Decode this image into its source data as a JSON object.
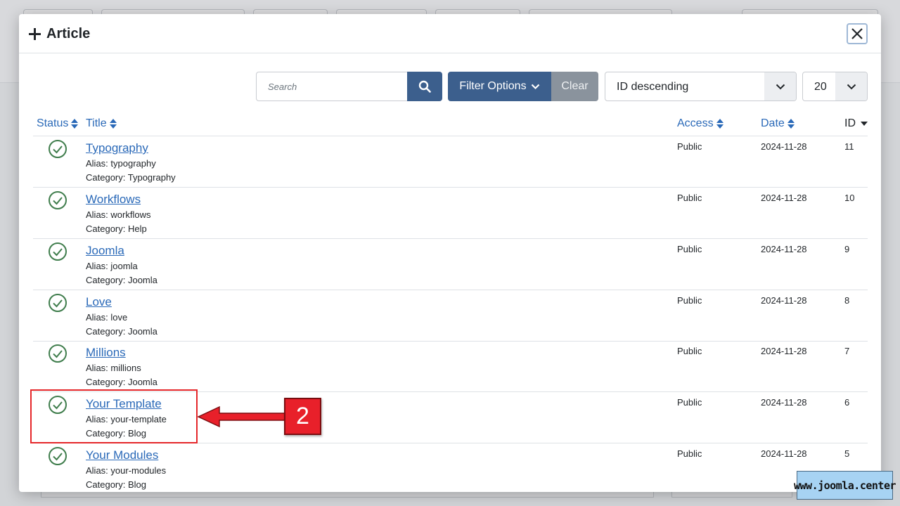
{
  "modal": {
    "title": "Article",
    "close_label": "×"
  },
  "search": {
    "placeholder": "Search"
  },
  "filters": {
    "filter_label": "Filter Options",
    "clear_label": "Clear",
    "sort_value": "ID descending",
    "limit_value": "20"
  },
  "table": {
    "headers": {
      "status": "Status",
      "title": "Title",
      "access": "Access",
      "date": "Date",
      "id": "ID"
    },
    "rows": [
      {
        "title": "Typography",
        "alias": "Alias: typography",
        "category": "Category: Typography",
        "access": "Public",
        "date": "2024-11-28",
        "id": "11"
      },
      {
        "title": "Workflows",
        "alias": "Alias: workflows",
        "category": "Category: Help",
        "access": "Public",
        "date": "2024-11-28",
        "id": "10"
      },
      {
        "title": "Joomla",
        "alias": "Alias: joomla",
        "category": "Category: Joomla",
        "access": "Public",
        "date": "2024-11-28",
        "id": "9"
      },
      {
        "title": "Love",
        "alias": "Alias: love",
        "category": "Category: Joomla",
        "access": "Public",
        "date": "2024-11-28",
        "id": "8"
      },
      {
        "title": "Millions",
        "alias": "Alias: millions",
        "category": "Category: Joomla",
        "access": "Public",
        "date": "2024-11-28",
        "id": "7"
      },
      {
        "title": "Your Template",
        "alias": "Alias: your-template",
        "category": "Category: Blog",
        "access": "Public",
        "date": "2024-11-28",
        "id": "6"
      },
      {
        "title": "Your Modules",
        "alias": "Alias: your-modules",
        "category": "Category: Blog",
        "access": "Public",
        "date": "2024-11-28",
        "id": "5"
      }
    ]
  },
  "annotation": {
    "step_number": "2"
  },
  "watermark": {
    "text": "www.joomla.center"
  },
  "colors": {
    "primary": "#3c5f8d",
    "link": "#2a69b8",
    "status_published": "#3f7d4c",
    "annotation_red": "#e5272a"
  }
}
